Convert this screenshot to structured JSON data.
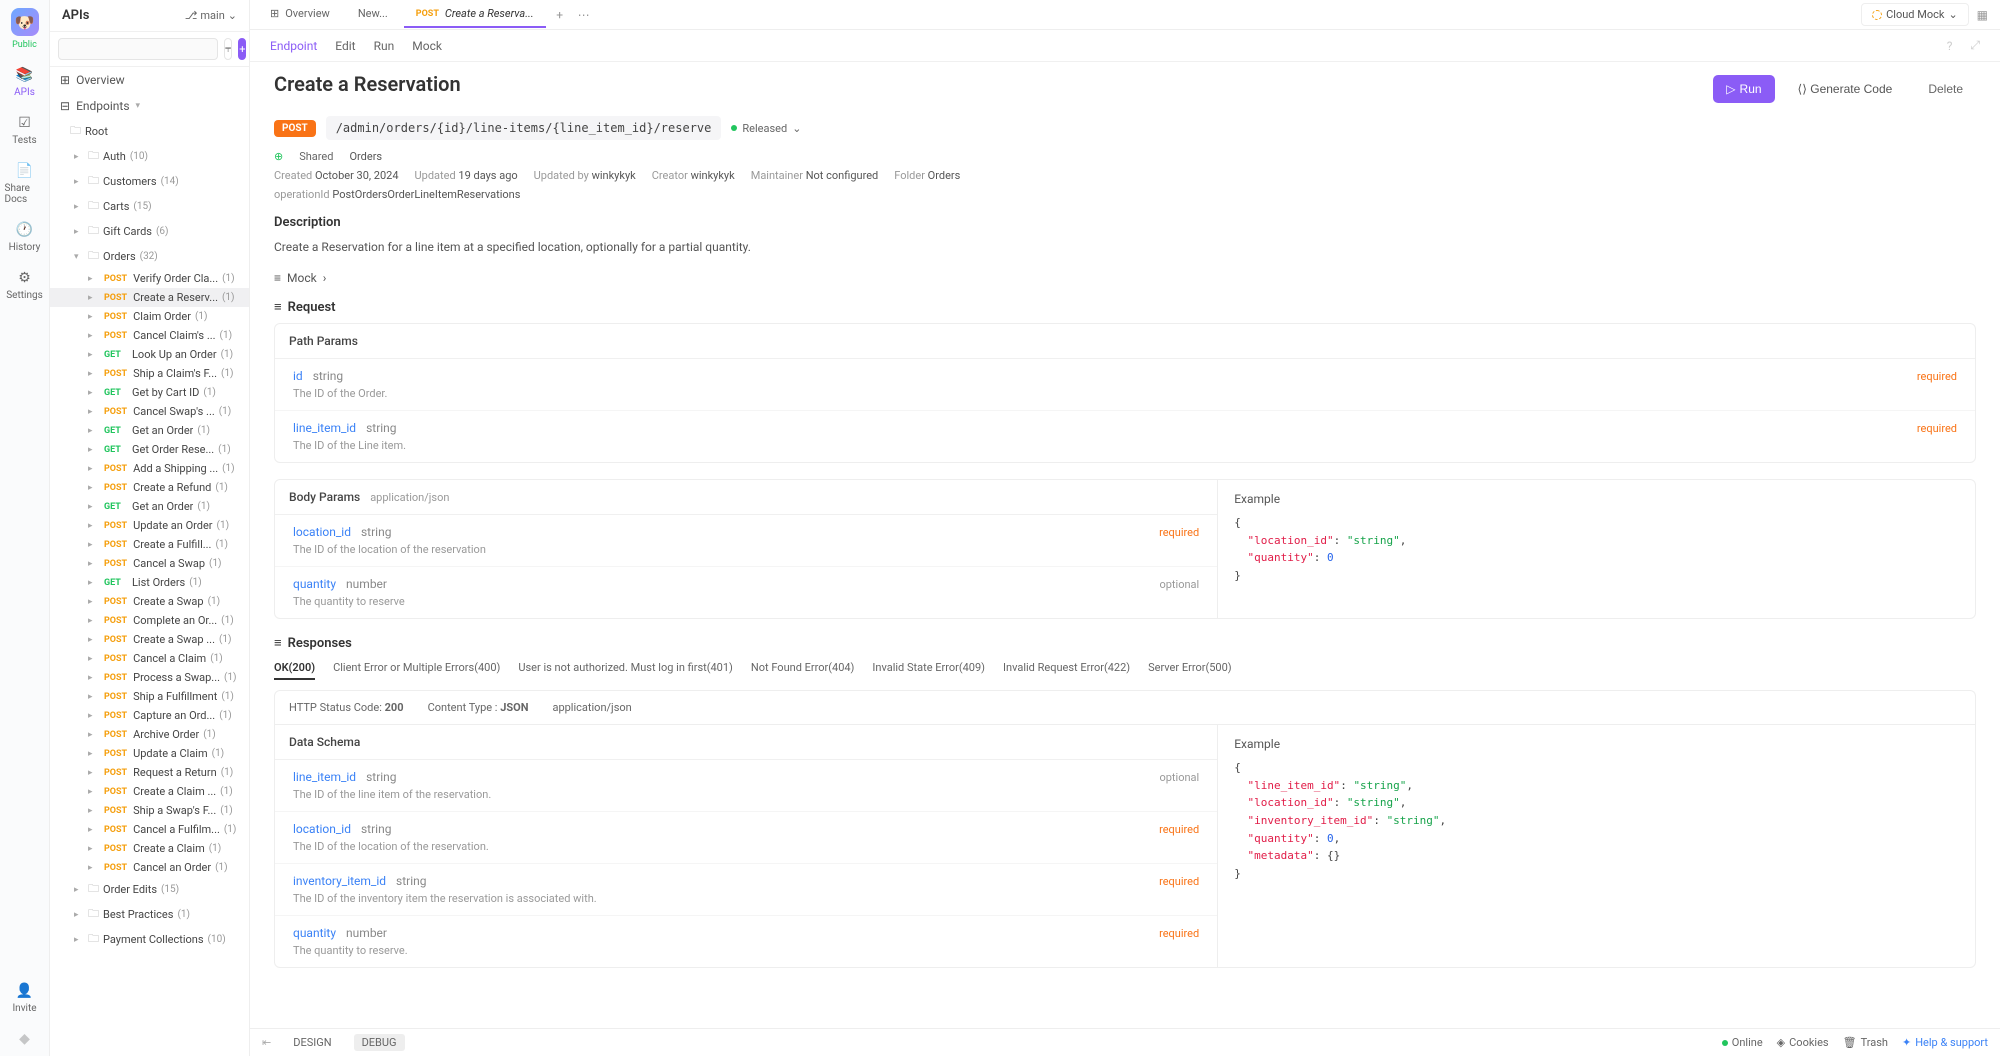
{
  "rail": {
    "public": "Public",
    "items": [
      {
        "id": "apis",
        "label": "APIs",
        "icon": "📚"
      },
      {
        "id": "tests",
        "label": "Tests",
        "icon": "✓"
      },
      {
        "id": "share",
        "label": "Share Docs",
        "icon": "📄"
      },
      {
        "id": "history",
        "label": "History",
        "icon": "🕐"
      },
      {
        "id": "settings",
        "label": "Settings",
        "icon": "⚙"
      }
    ],
    "invite": "Invite"
  },
  "sidebar": {
    "title": "APIs",
    "branch": "main",
    "search_placeholder": "",
    "overview": "Overview",
    "endpoints": "Endpoints",
    "root": "Root",
    "folders": [
      {
        "name": "Auth",
        "count": "(10)",
        "open": false
      },
      {
        "name": "Customers",
        "count": "(14)",
        "open": false
      },
      {
        "name": "Carts",
        "count": "(15)",
        "open": false
      },
      {
        "name": "Gift Cards",
        "count": "(6)",
        "open": false
      },
      {
        "name": "Orders",
        "count": "(32)",
        "open": true
      },
      {
        "name": "Order Edits",
        "count": "(15)",
        "open": false
      },
      {
        "name": "Best Practices",
        "count": "(1)",
        "open": false
      },
      {
        "name": "Payment Collections",
        "count": "(10)",
        "open": false
      }
    ],
    "orders_items": [
      {
        "m": "POST",
        "name": "Verify Order Cla...",
        "c": "(1)"
      },
      {
        "m": "POST",
        "name": "Create a Reserv...",
        "c": "(1)",
        "sel": true
      },
      {
        "m": "POST",
        "name": "Claim Order",
        "c": "(1)"
      },
      {
        "m": "POST",
        "name": "Cancel Claim's ...",
        "c": "(1)"
      },
      {
        "m": "GET",
        "name": "Look Up an Order",
        "c": "(1)"
      },
      {
        "m": "POST",
        "name": "Ship a Claim's F...",
        "c": "(1)"
      },
      {
        "m": "GET",
        "name": "Get by Cart ID",
        "c": "(1)"
      },
      {
        "m": "POST",
        "name": "Cancel Swap's ...",
        "c": "(1)"
      },
      {
        "m": "GET",
        "name": "Get an Order",
        "c": "(1)"
      },
      {
        "m": "GET",
        "name": "Get Order Rese...",
        "c": "(1)"
      },
      {
        "m": "POST",
        "name": "Add a Shipping ...",
        "c": "(1)"
      },
      {
        "m": "POST",
        "name": "Create a Refund",
        "c": "(1)"
      },
      {
        "m": "GET",
        "name": "Get an Order",
        "c": "(1)"
      },
      {
        "m": "POST",
        "name": "Update an Order",
        "c": "(1)"
      },
      {
        "m": "POST",
        "name": "Create a Fulfill...",
        "c": "(1)"
      },
      {
        "m": "POST",
        "name": "Cancel a Swap",
        "c": "(1)"
      },
      {
        "m": "GET",
        "name": "List Orders",
        "c": "(1)"
      },
      {
        "m": "POST",
        "name": "Create a Swap",
        "c": "(1)"
      },
      {
        "m": "POST",
        "name": "Complete an Or...",
        "c": "(1)"
      },
      {
        "m": "POST",
        "name": "Create a Swap ...",
        "c": "(1)"
      },
      {
        "m": "POST",
        "name": "Cancel a Claim",
        "c": "(1)"
      },
      {
        "m": "POST",
        "name": "Process a Swap...",
        "c": "(1)"
      },
      {
        "m": "POST",
        "name": "Ship a Fulfillment",
        "c": "(1)"
      },
      {
        "m": "POST",
        "name": "Capture an Ord...",
        "c": "(1)"
      },
      {
        "m": "POST",
        "name": "Archive Order",
        "c": "(1)"
      },
      {
        "m": "POST",
        "name": "Update a Claim",
        "c": "(1)"
      },
      {
        "m": "POST",
        "name": "Request a Return",
        "c": "(1)"
      },
      {
        "m": "POST",
        "name": "Create a Claim ...",
        "c": "(1)"
      },
      {
        "m": "POST",
        "name": "Ship a Swap's F...",
        "c": "(1)"
      },
      {
        "m": "POST",
        "name": "Cancel a Fulfilm...",
        "c": "(1)"
      },
      {
        "m": "POST",
        "name": "Create a Claim",
        "c": "(1)"
      },
      {
        "m": "POST",
        "name": "Cancel an Order",
        "c": "(1)"
      }
    ]
  },
  "tabs": [
    {
      "label": "Overview",
      "icon": "⊞"
    },
    {
      "label": "New..."
    },
    {
      "label": "Create a Reserva...",
      "method": "POST",
      "active": true
    }
  ],
  "env": "Cloud Mock",
  "subtabs": [
    "Endpoint",
    "Edit",
    "Run",
    "Mock"
  ],
  "page": {
    "title": "Create a Reservation",
    "method": "POST",
    "path": "/admin/orders/{id}/line-items/{line_item_id}/reserve",
    "status": "Released",
    "shared": "Shared",
    "folder_link": "Orders",
    "created_label": "Created",
    "created_val": "October 30, 2024",
    "updated_label": "Updated",
    "updated_val": "19 days ago",
    "updatedby_label": "Updated by",
    "updatedby_val": "winkykyk",
    "creator_label": "Creator",
    "creator_val": "winkykyk",
    "maintainer_label": "Maintainer",
    "maintainer_val": "Not configured",
    "folder_label": "Folder",
    "folder_val": "Orders",
    "opid_label": "operationId",
    "opid_val": "PostOrdersOrderLineItemReservations",
    "desc_h": "Description",
    "desc": "Create a Reservation for a line item at a specified location, optionally for a partial quantity.",
    "mock": "Mock",
    "request_h": "Request",
    "path_params_h": "Path Params",
    "body_params_h": "Body Params",
    "body_ct": "application/json",
    "path_params": [
      {
        "name": "id",
        "type": "string",
        "req": "required",
        "desc": "The ID of the Order."
      },
      {
        "name": "line_item_id",
        "type": "string",
        "req": "required",
        "desc": "The ID of the Line item."
      }
    ],
    "body_params": [
      {
        "name": "location_id",
        "type": "string",
        "req": "required",
        "desc": "The ID of the location of the reservation"
      },
      {
        "name": "quantity",
        "type": "number",
        "req": "optional",
        "desc": "The quantity to reserve"
      }
    ],
    "body_example": "{\n  \"location_id\": \"string\",\n  \"quantity\": 0\n}",
    "responses_h": "Responses",
    "resp_tabs": [
      "OK(200)",
      "Client Error or Multiple Errors(400)",
      "User is not authorized. Must log in first(401)",
      "Not Found Error(404)",
      "Invalid State Error(409)",
      "Invalid Request Error(422)",
      "Server Error(500)"
    ],
    "resp_status_label": "HTTP Status Code: ",
    "resp_status": "200",
    "resp_ct_label": "Content Type : ",
    "resp_ct": "JSON",
    "resp_ct2": "application/json",
    "schema_h": "Data Schema",
    "example_h": "Example",
    "resp_schema": [
      {
        "name": "line_item_id",
        "type": "string",
        "req": "optional",
        "desc": "The ID of the line item of the reservation."
      },
      {
        "name": "location_id",
        "type": "string",
        "req": "required",
        "desc": "The ID of the location of the reservation."
      },
      {
        "name": "inventory_item_id",
        "type": "string",
        "req": "required",
        "desc": "The ID of the inventory item the reservation is associated with."
      },
      {
        "name": "quantity",
        "type": "number",
        "req": "required",
        "desc": "The quantity to reserve."
      }
    ],
    "resp_example": "{\n  \"line_item_id\": \"string\",\n  \"location_id\": \"string\",\n  \"inventory_item_id\": \"string\",\n  \"quantity\": 0,\n  \"metadata\": {}\n}"
  },
  "actions": {
    "run": "Run",
    "gen": "Generate Code",
    "delete": "Delete"
  },
  "footer": {
    "design": "DESIGN",
    "debug": "DEBUG",
    "online": "Online",
    "cookies": "Cookies",
    "trash": "Trash",
    "help": "Help & support"
  }
}
